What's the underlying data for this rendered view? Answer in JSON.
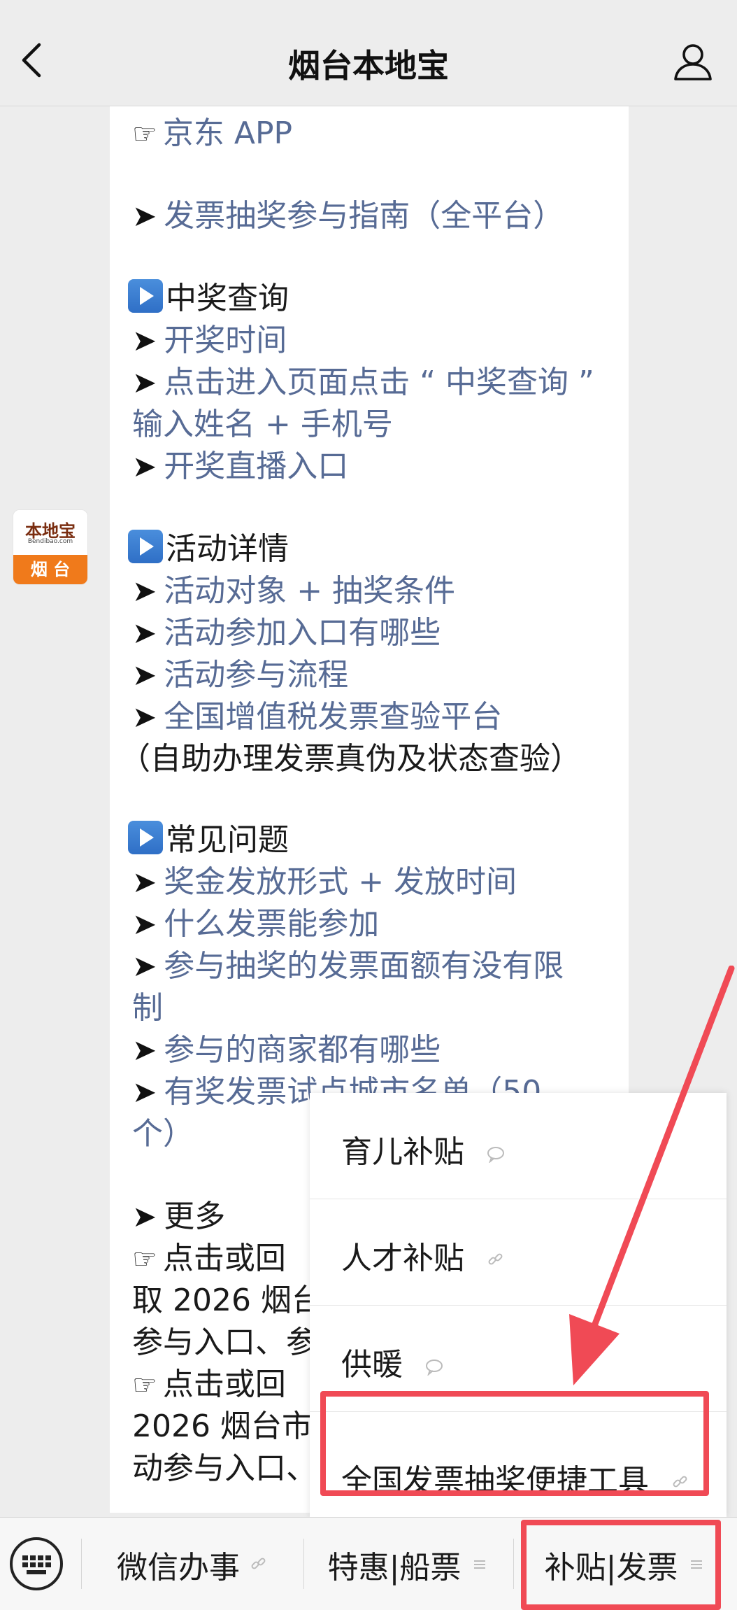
{
  "header": {
    "title": "烟台本地宝"
  },
  "bubble1": {
    "lines": [
      {
        "prefix": "☞",
        "text": "京东 APP"
      },
      {
        "prefix": "➤",
        "text": "发票抽奖参与指南（全平台）"
      },
      {
        "section": "中奖查询"
      },
      {
        "prefix": "➤",
        "text": "开奖时间"
      },
      {
        "prefix": "➤",
        "text": "点击进入页面点击 “ 中奖查询 ”"
      },
      {
        "text": "输入姓名 + 手机号"
      },
      {
        "prefix": "➤",
        "text": "开奖直播入口"
      }
    ]
  },
  "avatar": {
    "brand": "本地宝",
    "url": "Bendibao.com",
    "city": "烟 台"
  },
  "bubble2": {
    "section1": "活动详情",
    "l1": "活动对象 + 抽奖条件",
    "l2": "活动参加入口有哪些",
    "l3": "活动参与流程",
    "l4": "全国增值税发票查验平台",
    "l5": "（自助办理发票真伪及状态查验）",
    "section2": "常见问题",
    "l6": "奖金发放形式 + 发放时间",
    "l7": "什么发票能参加",
    "l8": "参与抽奖的发票面额有没有限",
    "l9": "制",
    "l10": "参与的商家都有哪些",
    "l11": "有奖发票试点城市名单（50",
    "l12": "个）",
    "l13": "更多",
    "l14": "点击或回",
    "l15": "取 2026 烟台",
    "l16": "参与入口、参",
    "l17": "点击或回",
    "l18": "2026 烟台市",
    "l19": "动参与入口、"
  },
  "popup": {
    "items": [
      {
        "label": "育儿补贴",
        "icon": "chat-icon"
      },
      {
        "label": "人才补贴",
        "icon": "link-icon"
      },
      {
        "label": "供暖",
        "icon": "chat-icon"
      },
      {
        "label": "全国发票抽奖便捷工具",
        "icon": "link-icon"
      }
    ]
  },
  "bottombar": {
    "tabs": [
      {
        "label": "微信办事",
        "icon": "link-icon"
      },
      {
        "label": "特惠|船票",
        "icon": "menu-icon"
      },
      {
        "label": "补贴|发票",
        "icon": "menu-icon"
      }
    ]
  },
  "colors": {
    "link": "#576b95",
    "highlight": "#f04a55",
    "accent_orange": "#f07a1b"
  }
}
